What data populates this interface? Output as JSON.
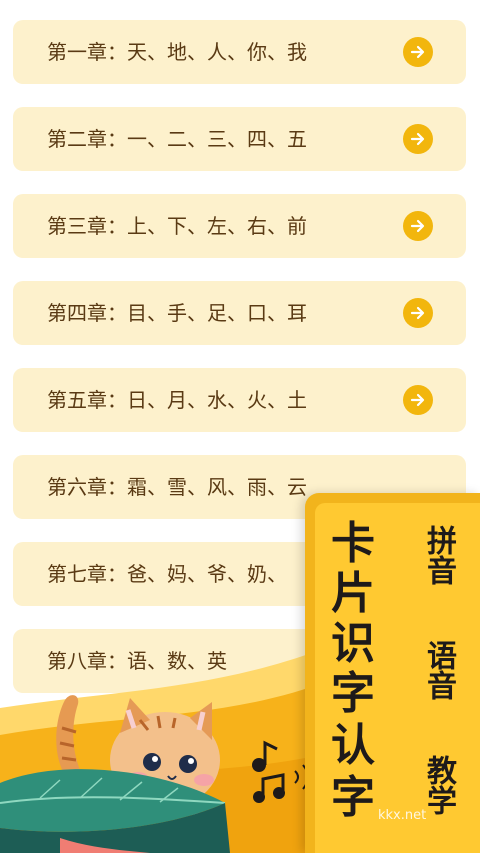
{
  "chapters": [
    {
      "label": "第一章：天、地、人、你、我"
    },
    {
      "label": "第二章：一、二、三、四、五"
    },
    {
      "label": "第三章：上、下、左、右、前"
    },
    {
      "label": "第四章：目、手、足、口、耳"
    },
    {
      "label": "第五章：日、月、水、火、土"
    },
    {
      "label": "第六章：霜、雪、风、雨、云"
    },
    {
      "label": "第七章：爸、妈、爷、奶、"
    },
    {
      "label": "第八章：语、数、英"
    }
  ],
  "promo": {
    "title_chars": [
      "卡",
      "片",
      "识",
      "字",
      "认",
      "字"
    ],
    "features": [
      "拼音",
      "语音",
      "教学"
    ]
  },
  "watermark": "kkx.net",
  "colors": {
    "card": "#fdf1cc",
    "accent": "#f2b60d",
    "text": "#5a3a14",
    "banner": "#ffc931"
  }
}
